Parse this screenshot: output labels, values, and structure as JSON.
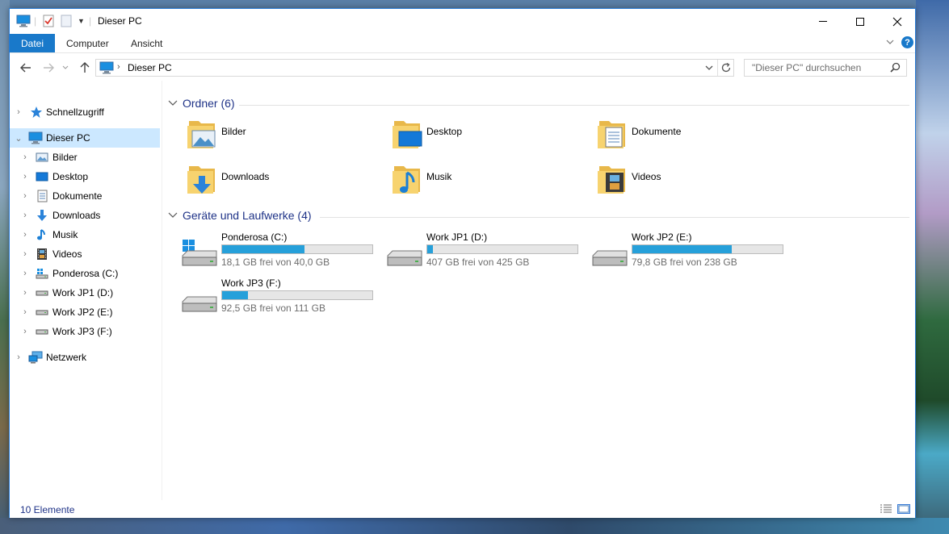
{
  "window": {
    "title": "Dieser PC"
  },
  "ribbon": {
    "tabs": [
      "Datei",
      "Computer",
      "Ansicht"
    ]
  },
  "address": {
    "path": "Dieser PC"
  },
  "search": {
    "placeholder": "\"Dieser PC\" durchsuchen"
  },
  "sidebar": {
    "items": [
      {
        "label": "Schnellzugriff",
        "icon": "star-icon"
      },
      {
        "label": "Dieser PC",
        "icon": "computer-icon"
      },
      {
        "label": "Bilder",
        "icon": "pictures-icon"
      },
      {
        "label": "Desktop",
        "icon": "desktop-icon"
      },
      {
        "label": "Dokumente",
        "icon": "documents-icon"
      },
      {
        "label": "Downloads",
        "icon": "download-icon"
      },
      {
        "label": "Musik",
        "icon": "music-icon"
      },
      {
        "label": "Videos",
        "icon": "videos-icon"
      },
      {
        "label": "Ponderosa (C:)",
        "icon": "system-drive-icon"
      },
      {
        "label": "Work JP1 (D:)",
        "icon": "drive-icon"
      },
      {
        "label": "Work JP2 (E:)",
        "icon": "drive-icon"
      },
      {
        "label": "Work JP3 (F:)",
        "icon": "drive-icon"
      },
      {
        "label": "Netzwerk",
        "icon": "network-icon"
      }
    ]
  },
  "folders": {
    "heading": "Ordner (6)",
    "items": [
      {
        "label": "Bilder",
        "icon": "pictures-folder-icon"
      },
      {
        "label": "Desktop",
        "icon": "desktop-folder-icon"
      },
      {
        "label": "Dokumente",
        "icon": "documents-folder-icon"
      },
      {
        "label": "Downloads",
        "icon": "downloads-folder-icon"
      },
      {
        "label": "Musik",
        "icon": "music-folder-icon"
      },
      {
        "label": "Videos",
        "icon": "videos-folder-icon"
      }
    ]
  },
  "drives": {
    "heading": "Geräte und Laufwerke (4)",
    "items": [
      {
        "name": "Ponderosa (C:)",
        "free": "18,1 GB frei von 40,0 GB",
        "used_fraction": 0.55,
        "icon": "windows-drive-icon"
      },
      {
        "name": "Work JP1 (D:)",
        "free": "407 GB frei von 425 GB",
        "used_fraction": 0.04,
        "icon": "hard-drive-icon"
      },
      {
        "name": "Work JP2 (E:)",
        "free": "79,8 GB frei von 238 GB",
        "used_fraction": 0.66,
        "icon": "hard-drive-icon"
      },
      {
        "name": "Work JP3 (F:)",
        "free": "92,5 GB frei von 111 GB",
        "used_fraction": 0.17,
        "icon": "hard-drive-icon"
      }
    ]
  },
  "status": {
    "count": "10 Elemente"
  },
  "colors": {
    "accent": "#1979ca",
    "progress": "#26a0da",
    "heading": "#1e3287",
    "selected": "#cce8ff"
  }
}
